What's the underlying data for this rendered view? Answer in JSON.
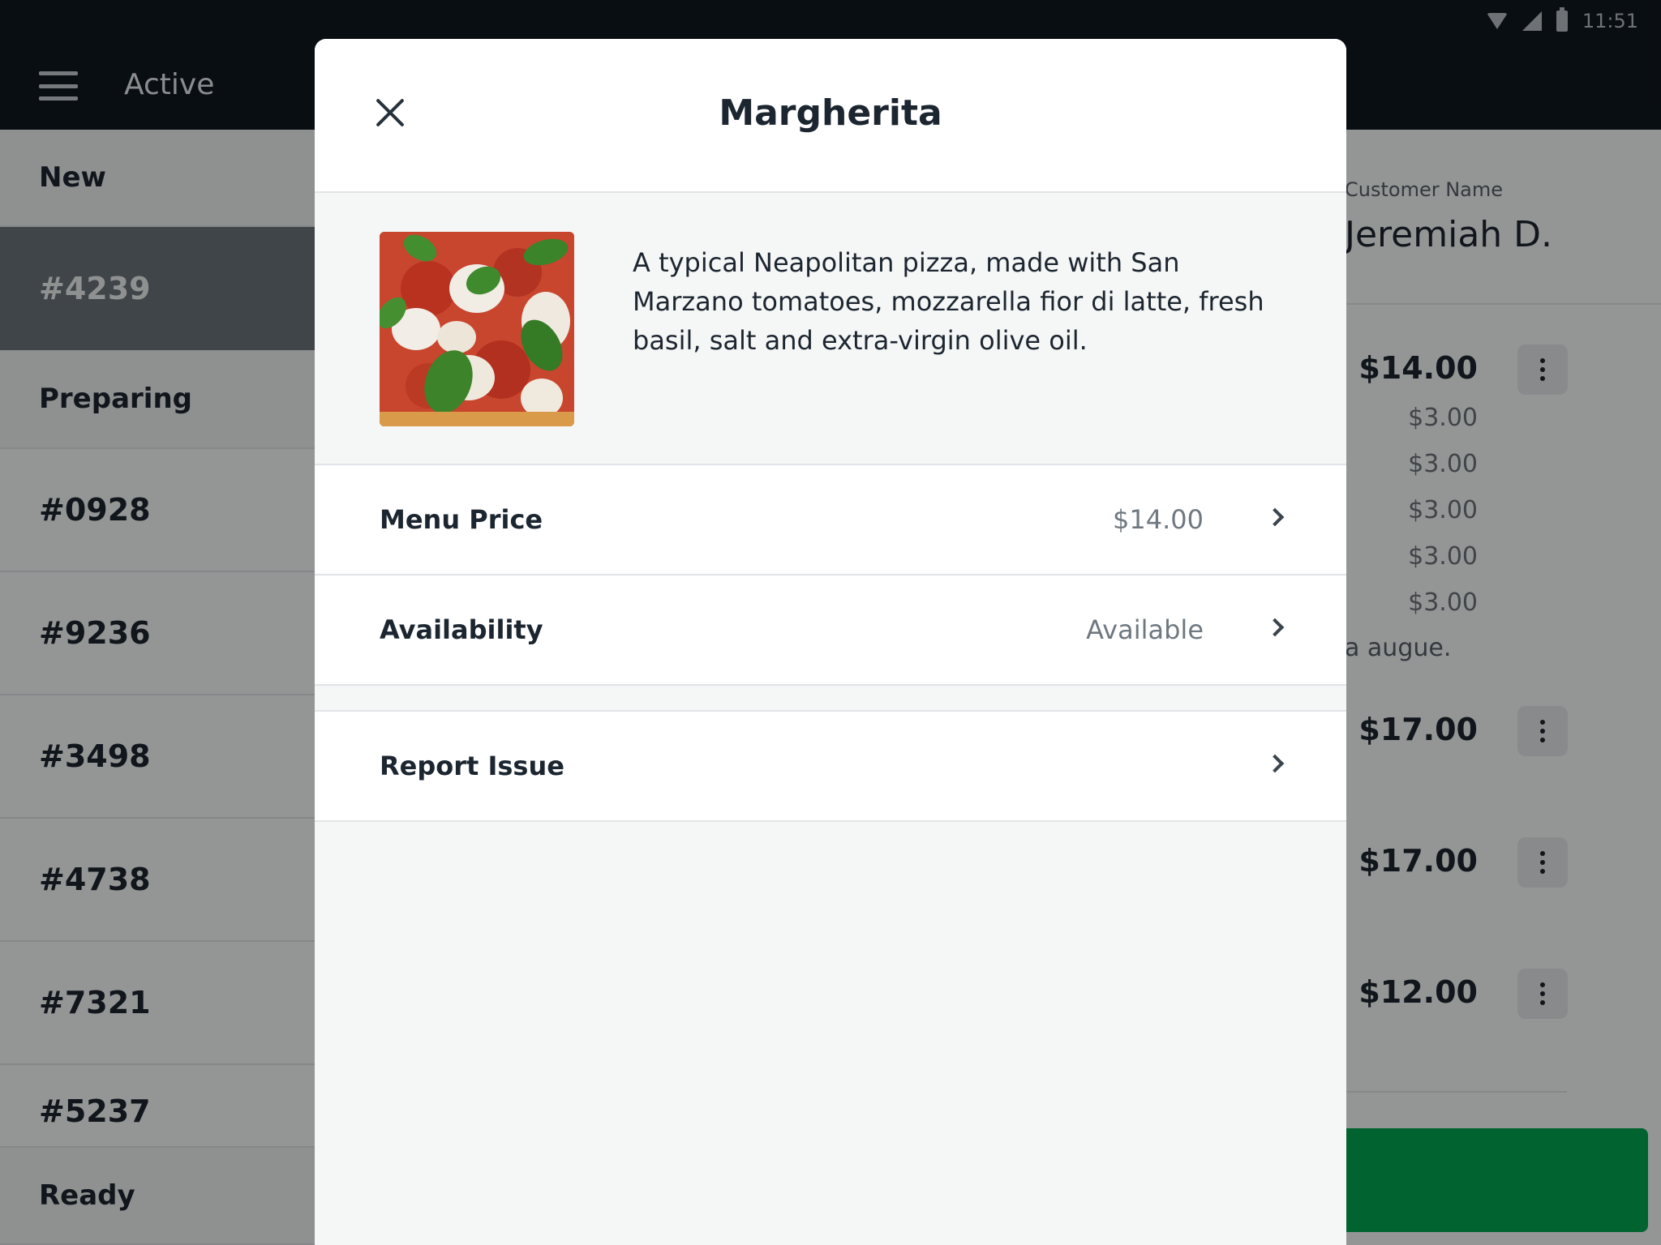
{
  "status_bar": {
    "time": "11:51"
  },
  "app_bar": {
    "title": "Active"
  },
  "sidebar": {
    "new_label": "New",
    "new_orders": [
      "#4239"
    ],
    "preparing_label": "Preparing",
    "preparing_orders": [
      "#0928",
      "#9236",
      "#3498",
      "#4738",
      "#7321",
      "#5237"
    ],
    "ready_label": "Ready"
  },
  "detail": {
    "customer_label": "Customer Name",
    "customer_name": "Jeremiah D.",
    "items": [
      {
        "price": "$14.00",
        "modifiers": [
          "$3.00",
          "$3.00",
          "$3.00",
          "$3.00",
          "$3.00"
        ],
        "note": "a augue."
      },
      {
        "price": "$17.00"
      },
      {
        "price": "$17.00"
      },
      {
        "price": "$12.00"
      }
    ],
    "primary_button_color": "#00a651"
  },
  "modal": {
    "title": "Margherita",
    "description": "A typical Neapolitan pizza, made with San Marzano tomatoes, mozzarella fior di latte, fresh basil, salt and extra-virgin olive oil.",
    "rows": [
      {
        "label": "Menu Price",
        "value": "$14.00"
      },
      {
        "label": "Availability",
        "value": "Available"
      }
    ],
    "report_label": "Report Issue"
  }
}
